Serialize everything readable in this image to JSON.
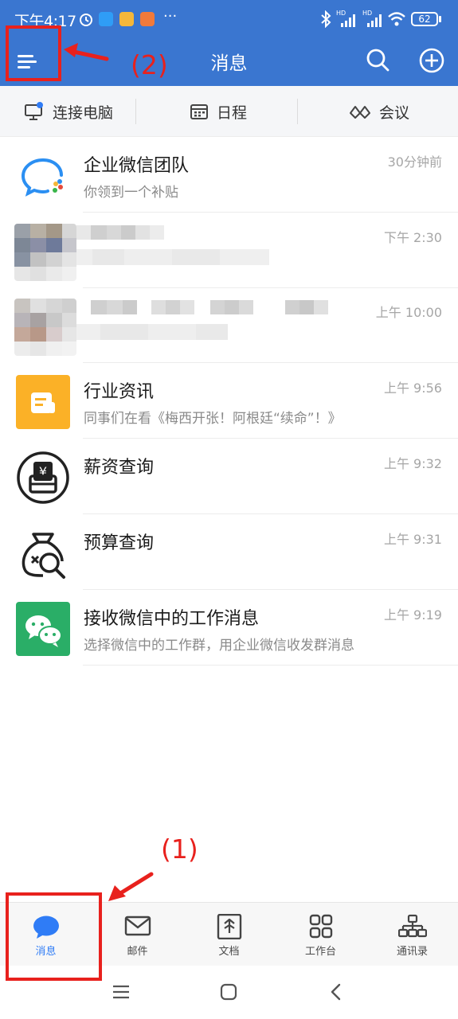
{
  "status_bar": {
    "time": "下午4:17",
    "dots": "···",
    "network_1": "HD",
    "network_2": "HD",
    "battery": "62"
  },
  "header": {
    "title": "消息",
    "menu_icon": "hamburger-menu-icon",
    "search_icon": "search-icon",
    "add_icon": "plus-circle-icon"
  },
  "annotations": {
    "label_1": "(1)",
    "label_2": "(2)",
    "color": "#e8211d"
  },
  "quick_actions": [
    {
      "label": "连接电脑",
      "icon": "monitor-icon"
    },
    {
      "label": "日程",
      "icon": "calendar-icon"
    },
    {
      "label": "会议",
      "icon": "meeting-icon"
    }
  ],
  "messages": [
    {
      "name": "企业微信团队",
      "preview": "你领到一个补贴",
      "time": "30分钟前",
      "avatar": "wecom-logo-icon"
    },
    {
      "name": "",
      "preview": "",
      "time": "下午 2:30",
      "avatar": "blurred"
    },
    {
      "name": "",
      "preview": "",
      "time": "上午 10:00",
      "avatar": "blurred"
    },
    {
      "name": "行业资讯",
      "preview": "同事们在看《梅西开张！阿根廷“续命”！》",
      "time": "上午 9:56",
      "avatar": "news-icon"
    },
    {
      "name": "薪资查询",
      "preview": "",
      "time": "上午 9:32",
      "avatar": "salary-icon"
    },
    {
      "name": "预算查询",
      "preview": "",
      "time": "上午 9:31",
      "avatar": "budget-icon"
    },
    {
      "name": "接收微信中的工作消息",
      "preview": "选择微信中的工作群，用企业微信收发群消息",
      "time": "上午 9:19",
      "avatar": "wechat-icon"
    }
  ],
  "bottom_nav": [
    {
      "label": "消息",
      "icon": "chat-bubble-icon",
      "active": true
    },
    {
      "label": "邮件",
      "icon": "mail-icon",
      "active": false
    },
    {
      "label": "文档",
      "icon": "document-icon",
      "active": false
    },
    {
      "label": "工作台",
      "icon": "workbench-grid-icon",
      "active": false
    },
    {
      "label": "通讯录",
      "icon": "contacts-org-icon",
      "active": false
    }
  ],
  "colors": {
    "header": "#3a76d0",
    "accent": "#2f7cf6",
    "annotation": "#e8211d"
  }
}
